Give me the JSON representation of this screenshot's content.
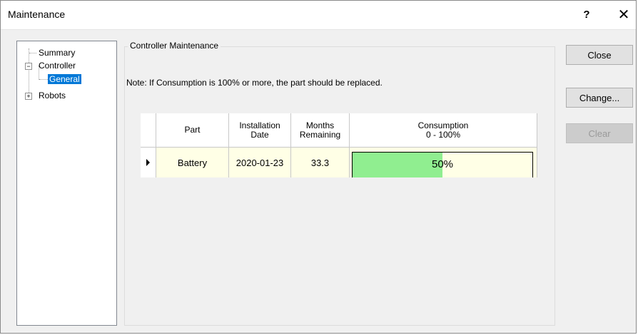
{
  "window": {
    "title": "Maintenance",
    "help_glyph": "?",
    "close_glyph": "✕"
  },
  "tree": {
    "items": [
      {
        "label": "Summary"
      },
      {
        "label": "Controller",
        "expander": "−"
      },
      {
        "label": "General",
        "selected": true
      },
      {
        "label": "Robots",
        "expander": "+"
      }
    ]
  },
  "group": {
    "title": "Controller Maintenance",
    "note": "Note: If Consumption is 100% or more, the part should be replaced."
  },
  "grid": {
    "columns": [
      "Part",
      "Installation\nDate",
      "Months\nRemaining",
      "Consumption\n0 - 100%"
    ],
    "rows": [
      {
        "part": "Battery",
        "installation_date": "2020-01-23",
        "months_remaining": "33.3",
        "consumption_text": "50%",
        "consumption_fraction": 0.5
      }
    ]
  },
  "buttons": {
    "close": "Close",
    "change": "Change...",
    "clear": "Clear"
  },
  "colors": {
    "selection": "#0078d7",
    "consumption_fill": "#90ee90",
    "row_background": "#ffffe6"
  },
  "icons": {
    "row_pointer": "row-selector-arrow-icon"
  }
}
